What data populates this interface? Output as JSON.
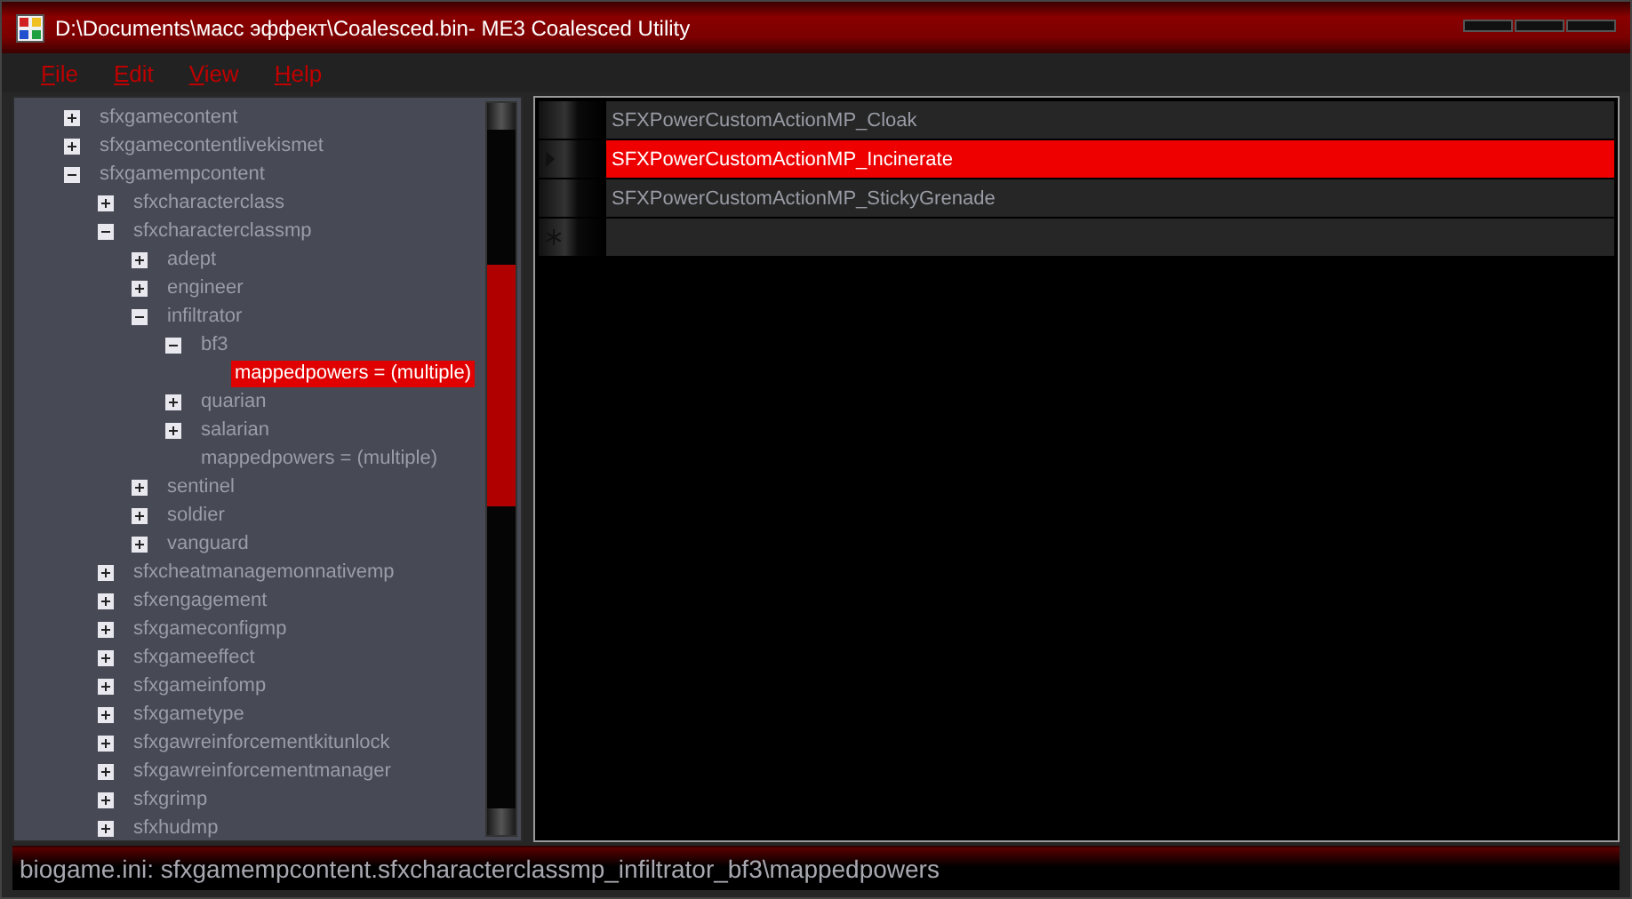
{
  "window": {
    "title": "D:\\Documents\\масс эффект\\Coalesced.bin- ME3 Coalesced Utility"
  },
  "menu": [
    {
      "mnemonic": "F",
      "rest": "ile"
    },
    {
      "mnemonic": "E",
      "rest": "dit"
    },
    {
      "mnemonic": "V",
      "rest": "iew"
    },
    {
      "mnemonic": "H",
      "rest": "elp"
    }
  ],
  "tree": [
    {
      "label": "sfxgamecontent",
      "kind": "node",
      "expanded": false,
      "selected": false
    },
    {
      "label": "sfxgamecontentlivekismet",
      "kind": "node",
      "expanded": false,
      "selected": false
    },
    {
      "label": "sfxgamempcontent",
      "kind": "node",
      "expanded": true,
      "selected": false,
      "children": [
        {
          "label": "sfxcharacterclass",
          "kind": "node",
          "expanded": false,
          "selected": false
        },
        {
          "label": "sfxcharacterclassmp",
          "kind": "node",
          "expanded": true,
          "selected": false,
          "children": [
            {
              "label": "adept",
              "kind": "node",
              "expanded": false,
              "selected": false
            },
            {
              "label": "engineer",
              "kind": "node",
              "expanded": false,
              "selected": false
            },
            {
              "label": "infiltrator",
              "kind": "node",
              "expanded": true,
              "selected": false,
              "children": [
                {
                  "label": "bf3",
                  "kind": "node",
                  "expanded": true,
                  "selected": false,
                  "children": [
                    {
                      "label": "mappedpowers = (multiple)",
                      "kind": "leaf",
                      "selected": true
                    }
                  ]
                },
                {
                  "label": "quarian",
                  "kind": "node",
                  "expanded": false,
                  "selected": false
                },
                {
                  "label": "salarian",
                  "kind": "node",
                  "expanded": false,
                  "selected": false
                },
                {
                  "label": "mappedpowers = (multiple)",
                  "kind": "leaf",
                  "selected": false
                }
              ]
            },
            {
              "label": "sentinel",
              "kind": "node",
              "expanded": false,
              "selected": false
            },
            {
              "label": "soldier",
              "kind": "node",
              "expanded": false,
              "selected": false
            },
            {
              "label": "vanguard",
              "kind": "node",
              "expanded": false,
              "selected": false
            }
          ]
        },
        {
          "label": "sfxcheatmanagemonnativemp",
          "kind": "node",
          "expanded": false,
          "selected": false
        },
        {
          "label": "sfxengagement",
          "kind": "node",
          "expanded": false,
          "selected": false
        },
        {
          "label": "sfxgameconfigmp",
          "kind": "node",
          "expanded": false,
          "selected": false
        },
        {
          "label": "sfxgameeffect",
          "kind": "node",
          "expanded": false,
          "selected": false
        },
        {
          "label": "sfxgameinfomp",
          "kind": "node",
          "expanded": false,
          "selected": false
        },
        {
          "label": "sfxgametype",
          "kind": "node",
          "expanded": false,
          "selected": false
        },
        {
          "label": "sfxgawreinforcementkitunlock",
          "kind": "node",
          "expanded": false,
          "selected": false
        },
        {
          "label": "sfxgawreinforcementmanager",
          "kind": "node",
          "expanded": false,
          "selected": false
        },
        {
          "label": "sfxgrimp",
          "kind": "node",
          "expanded": false,
          "selected": false
        },
        {
          "label": "sfxhudmp",
          "kind": "node",
          "expanded": false,
          "selected": false
        }
      ]
    }
  ],
  "grid": {
    "rows": [
      {
        "kind": "value",
        "value": "SFXPowerCustomActionMP_Cloak",
        "selected": false
      },
      {
        "kind": "value",
        "value": "SFXPowerCustomActionMP_Incinerate",
        "selected": true
      },
      {
        "kind": "value",
        "value": "SFXPowerCustomActionMP_StickyGrenade",
        "selected": false
      },
      {
        "kind": "new",
        "selected": false
      }
    ]
  },
  "status_bar": {
    "text": "biogame.ini: sfxgamempcontent.sfxcharacterclassmp_infiltrator_bf3\\mappedpowers"
  }
}
